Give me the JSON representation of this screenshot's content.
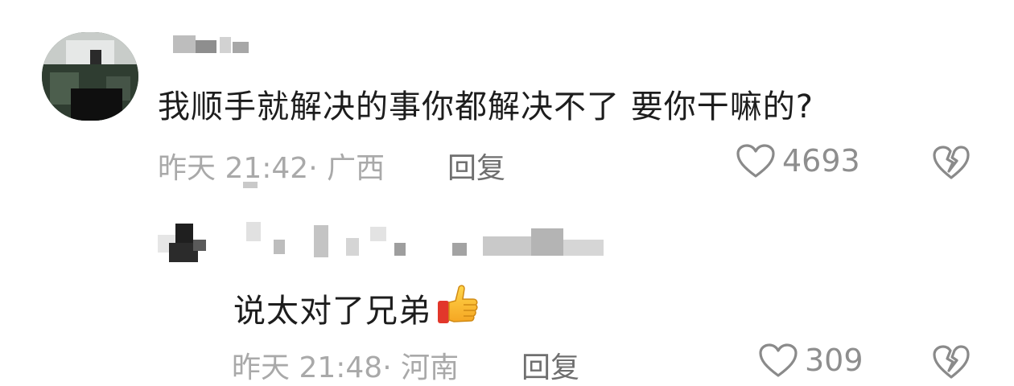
{
  "main_comment": {
    "text": "我顺手就解决的事你都解决不了  要你干嘛的?",
    "meta": "昨天 21:42· 广西",
    "reply_label": "回复",
    "like_count": "4693",
    "icons": [
      "heart-icon",
      "broken-heart-icon"
    ]
  },
  "reply_comment": {
    "text": "说太对了兄弟",
    "emoji": "thumbs-up-emoji",
    "meta": "昨天 21:48· 河南",
    "reply_label": "回复",
    "like_count": "309",
    "icons": [
      "heart-icon",
      "broken-heart-icon"
    ]
  },
  "colors": {
    "text_primary": "#1d1d1d",
    "meta_gray": "#a9a9a9",
    "reply_gray": "#6f6f6f",
    "count_gray": "#8e8e8e",
    "icon_gray": "#8a8a8a"
  }
}
